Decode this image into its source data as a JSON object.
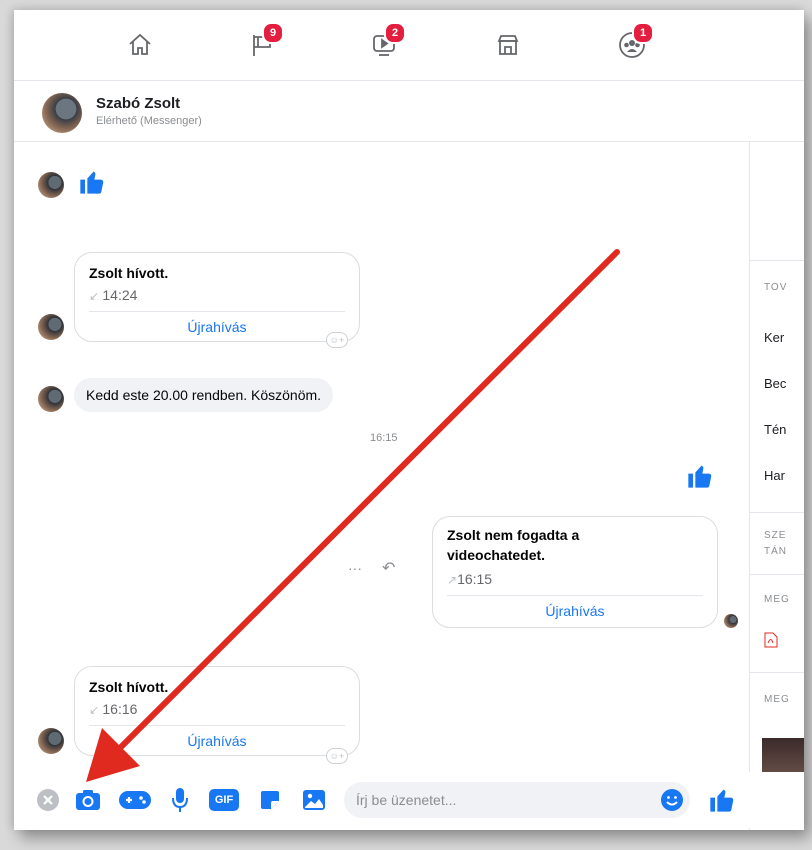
{
  "colors": {
    "accent": "#1877f2",
    "badge": "#e41e3f",
    "arrow": "#e02a1f"
  },
  "nav": [
    {
      "name": "home-icon",
      "badge": ""
    },
    {
      "name": "flag-icon",
      "badge": "9"
    },
    {
      "name": "video-icon",
      "badge": "2"
    },
    {
      "name": "marketplace-icon",
      "badge": ""
    },
    {
      "name": "groups-icon",
      "badge": "1"
    }
  ],
  "header": {
    "name": "Szabó Zsolt",
    "status": "Elérhető (Messenger)"
  },
  "messages": {
    "call1": {
      "title": "Zsolt hívott.",
      "time": "14:24",
      "action": "Újrahívás"
    },
    "text1": "Kedd este 20.00 rendben. Köszönöm.",
    "timestamp": "16:15",
    "call2": {
      "title": "Zsolt nem fogadta a videochatedet.",
      "time": "16:15",
      "action": "Újrahívás"
    },
    "call3": {
      "title": "Zsolt hívott.",
      "time": "16:16",
      "action": "Újrahívás"
    }
  },
  "right_panel": {
    "items": [
      "TOV",
      "Ker",
      "Bec",
      "Tén",
      "Har",
      "SZE",
      "TÁN",
      "MEG",
      "MEG"
    ]
  },
  "composer": {
    "placeholder": "Írj be üzenetet...",
    "gif_label": "GIF"
  }
}
